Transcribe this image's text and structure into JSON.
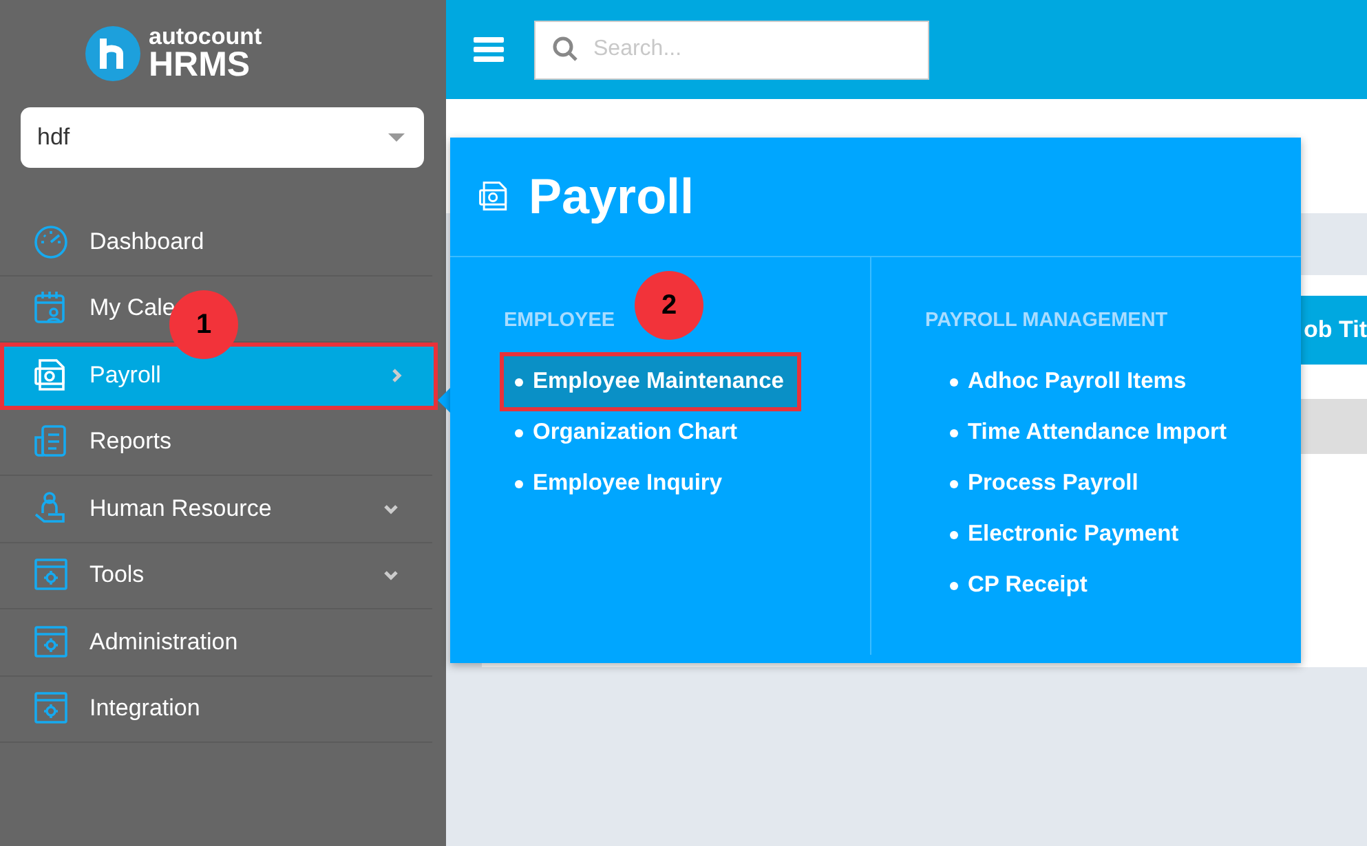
{
  "sidebar": {
    "logo": {
      "brand": "autocount",
      "product": "HRMS"
    },
    "company_select": {
      "value": "hdf"
    },
    "items": [
      {
        "label": "Dashboard",
        "kind": "link",
        "selected": false
      },
      {
        "label": "My Cale",
        "kind": "link",
        "selected": false
      },
      {
        "label": "Payroll",
        "kind": "submenu",
        "selected": true
      },
      {
        "label": "Reports",
        "kind": "link",
        "selected": false
      },
      {
        "label": "Human Resource",
        "kind": "dropdown",
        "selected": false
      },
      {
        "label": "Tools",
        "kind": "dropdown",
        "selected": false
      },
      {
        "label": "Administration",
        "kind": "link",
        "selected": false
      },
      {
        "label": "Integration",
        "kind": "link",
        "selected": false
      }
    ]
  },
  "topbar": {
    "search": {
      "placeholder": "Search..."
    }
  },
  "background_table": {
    "header_fragment": "ob Tit"
  },
  "flyout": {
    "title": "Payroll",
    "columns": [
      {
        "heading": "EMPLOYEE",
        "items": [
          {
            "label": "Employee Maintenance",
            "selected": true
          },
          {
            "label": "Organization Chart",
            "selected": false
          },
          {
            "label": "Employee Inquiry",
            "selected": false
          }
        ]
      },
      {
        "heading": "PAYROLL MANAGEMENT",
        "items": [
          {
            "label": "Adhoc Payroll Items",
            "selected": false
          },
          {
            "label": "Time Attendance Import",
            "selected": false
          },
          {
            "label": "Process Payroll",
            "selected": false
          },
          {
            "label": "Electronic Payment",
            "selected": false
          },
          {
            "label": "CP Receipt",
            "selected": false
          }
        ]
      }
    ]
  },
  "step_badges": [
    {
      "number": "1"
    },
    {
      "number": "2"
    }
  ]
}
